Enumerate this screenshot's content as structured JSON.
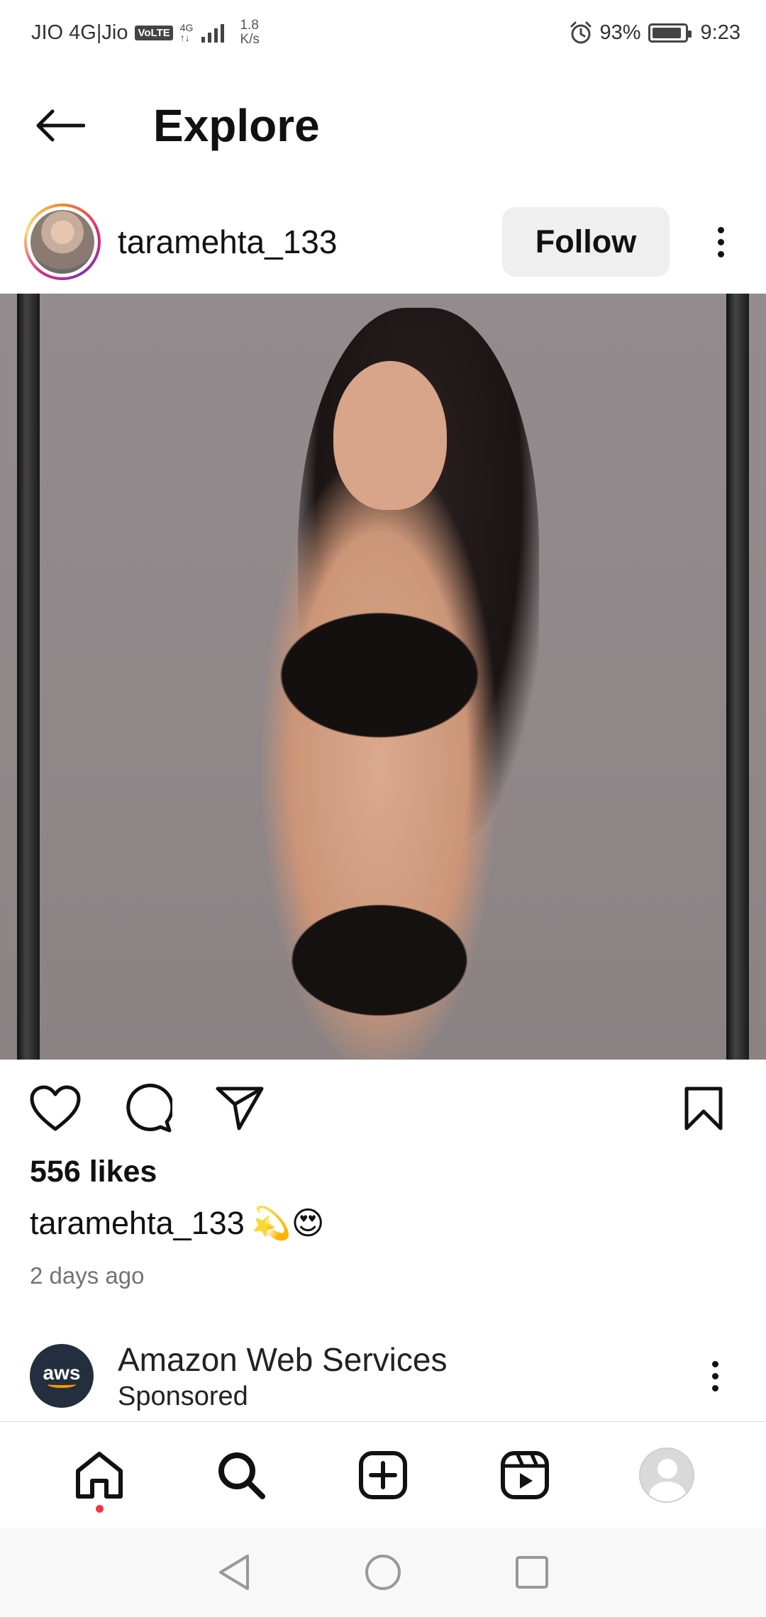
{
  "status_bar": {
    "carrier": "JIO 4G|Jio",
    "volte": "VoLTE",
    "net_type_top": "4G",
    "net_type_bottom": "↑↓",
    "speed_value": "1.8",
    "speed_unit": "K/s",
    "battery_percent": "93%",
    "battery_level": 0.93,
    "time": "9:23"
  },
  "header": {
    "title": "Explore"
  },
  "post": {
    "username": "taramehta_133",
    "follow_label": "Follow",
    "likes": "556 likes",
    "caption_user": "taramehta_133",
    "caption_emoji": "💫😍",
    "timestamp": "2 days ago"
  },
  "sponsored": {
    "name": "Amazon Web Services",
    "label": "Sponsored",
    "logo_text": "aws"
  },
  "colors": {
    "accent_red": "#ff3040",
    "follow_bg": "#efefef",
    "aws_bg": "#232f3e",
    "aws_orange": "#ff9900"
  },
  "icons": {
    "back": "arrow-left-icon",
    "like": "heart-icon",
    "comment": "comment-icon",
    "share": "send-icon",
    "save": "bookmark-icon",
    "home": "home-icon",
    "search": "search-icon",
    "create": "plus-square-icon",
    "reels": "reels-icon",
    "profile": "avatar-icon"
  }
}
